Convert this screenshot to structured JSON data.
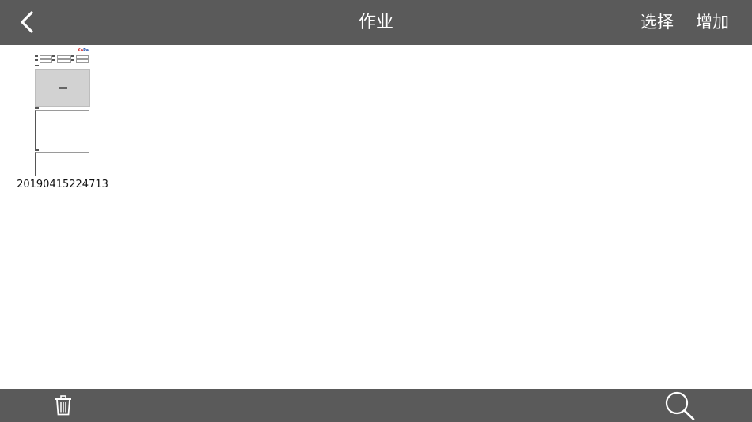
{
  "navbar": {
    "title": "作业",
    "back_icon": "chevron-left-icon",
    "select_label": "选择",
    "add_label": "增加",
    "background": "#5a5a5a",
    "text_color": "#ffffff"
  },
  "files": [
    {
      "name": "20190415224713",
      "thumbnail_logo_k": "Ko",
      "thumbnail_logo_p": "Pa"
    }
  ],
  "toolbar": {
    "delete_icon": "trash-icon",
    "search_icon": "search-icon",
    "background": "#5a5a5a"
  }
}
